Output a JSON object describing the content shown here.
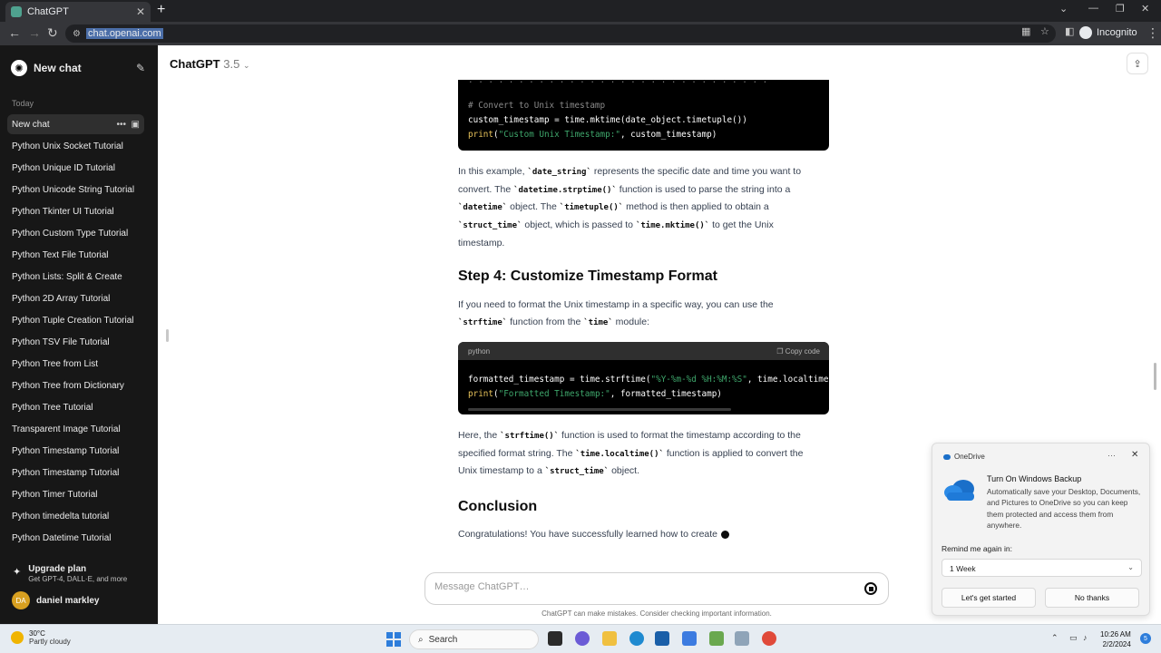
{
  "browser": {
    "tab_title": "ChatGPT",
    "tab_close": "✕",
    "new_tab": "+",
    "url": "chat.openai.com",
    "incognito_label": "Incognito"
  },
  "sidebar": {
    "new_chat": "New chat",
    "section_today": "Today",
    "active_chat": "New chat",
    "items": [
      "Python Unix Socket Tutorial",
      "Python Unique ID Tutorial",
      "Python Unicode String Tutorial",
      "Python Tkinter UI Tutorial",
      "Python Custom Type Tutorial",
      "Python Text File Tutorial",
      "Python Lists: Split & Create",
      "Python 2D Array Tutorial",
      "Python Tuple Creation Tutorial",
      "Python TSV File Tutorial",
      "Python Tree from List",
      "Python Tree from Dictionary",
      "Python Tree Tutorial",
      "Transparent Image Tutorial",
      "Python Timestamp Tutorial",
      "Python Timestamp Tutorial",
      "Python Timer Tutorial",
      "Python timedelta tutorial",
      "Python Datetime Tutorial"
    ],
    "upgrade_title": "Upgrade plan",
    "upgrade_sub": "Get GPT-4, DALL·E, and more",
    "user_initials": "DA",
    "user_name": "daniel markley"
  },
  "header": {
    "model": "ChatGPT",
    "version": "3.5"
  },
  "content": {
    "code1": {
      "comment": "# Convert to Unix timestamp",
      "line2": "custom_timestamp = time.mktime(date_object.timetuple())",
      "print_kw": "print",
      "print_str": "\"Custom Unix Timestamp:\"",
      "print_rest": ", custom_timestamp)"
    },
    "para1": {
      "t1": "In this example, ",
      "c1": "`date_string`",
      "t2": " represents the specific date and time you want to convert. The ",
      "c2": "`datetime.strptime()`",
      "t3": " function is used to parse the string into a ",
      "c3": "`datetime`",
      "t4": " object. The ",
      "c4": "`timetuple()`",
      "t5": " method is then applied to obtain a ",
      "c5": "`struct_time`",
      "t6": " object, which is passed to ",
      "c6": "`time.mktime()`",
      "t7": " to get the Unix timestamp."
    },
    "heading_step4": "Step 4: Customize Timestamp Format",
    "para2": {
      "t1": "If you need to format the Unix timestamp in a specific way, you can use the ",
      "c1": "`strftime`",
      "t2": " function from the ",
      "c2": "`time`",
      "t3": " module:"
    },
    "code2": {
      "lang": "python",
      "copy": "Copy code",
      "l1_a": "formatted_timestamp = time.strftime(",
      "l1_str": "\"%Y-%m-%d %H:%M:%S\"",
      "l1_b": ", time.localtime",
      "print_kw": "print",
      "print_str": "\"Formatted Timestamp:\"",
      "print_rest": ", formatted_timestamp)"
    },
    "para3": {
      "t1": "Here, the ",
      "c1": "`strftime()`",
      "t2": " function is used to format the timestamp according to the specified format string. The ",
      "c2": "`time.localtime()`",
      "t3": " function is applied to convert the Unix timestamp to a ",
      "c3": "`struct_time`",
      "t4": " object."
    },
    "heading_conclusion": "Conclusion",
    "para4": "Congratulations! You have successfully learned how to create"
  },
  "input": {
    "placeholder": "Message ChatGPT…",
    "disclaimer": "ChatGPT can make mistakes. Consider checking important information."
  },
  "onedrive": {
    "app": "OneDrive",
    "dots": "···",
    "close": "✕",
    "heading": "Turn On Windows Backup",
    "body": "Automatically save your Desktop, Documents, and Pictures to OneDrive so you can keep them protected and access them from anywhere.",
    "remind_label": "Remind me again in:",
    "remind_value": "1 Week",
    "primary_button": "Let's get started",
    "secondary_button": "No thanks"
  },
  "taskbar": {
    "temp": "30°C",
    "weather": "Partly cloudy",
    "search": "Search",
    "time": "10:26 AM",
    "date": "2/2/2024",
    "notifications": "5"
  },
  "colors": {
    "sidebar_bg": "#171717",
    "code_bg": "#000000",
    "code_string": "#3ea66b",
    "code_keyword": "#e6c15a"
  }
}
